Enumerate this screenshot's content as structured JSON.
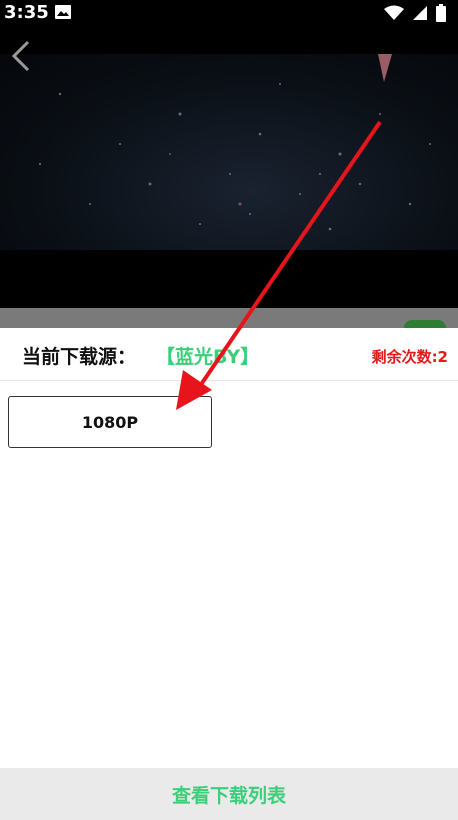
{
  "status_bar": {
    "time": "3:35",
    "icons": [
      "image-icon",
      "wifi-icon",
      "signal-icon",
      "battery-icon"
    ]
  },
  "video": {
    "back_icon": "chevron-left-icon"
  },
  "download_sheet": {
    "source_label": "当前下载源：",
    "source_value": "【蓝光BY】",
    "remaining": "剩余次数:2",
    "quality_options": [
      "1080P"
    ]
  },
  "footer": {
    "view_list_label": "查看下载列表"
  },
  "annotation": {
    "arrow_color": "#e8141b"
  },
  "colors": {
    "accent_green": "#3ccf7a",
    "warning_red": "#e01b1b"
  }
}
